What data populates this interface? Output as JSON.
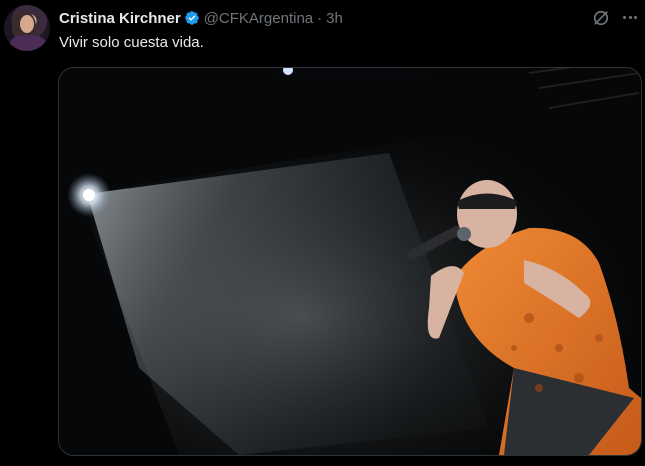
{
  "tweet": {
    "author_name": "Cristina Kirchner",
    "handle": "@CFKArgentina",
    "separator": "·",
    "time": "3h",
    "text": "Vivir solo cuesta vida.",
    "verified": true
  },
  "icons": {
    "avatar": "profile-photo",
    "verified": "verified-badge-icon",
    "grok": "grok-icon",
    "more": "more-options-icon"
  },
  "colors": {
    "background": "#000000",
    "text_primary": "#e7e9ea",
    "text_secondary": "#71767b",
    "verified_blue": "#1d9bf0",
    "border": "#2f3336"
  }
}
